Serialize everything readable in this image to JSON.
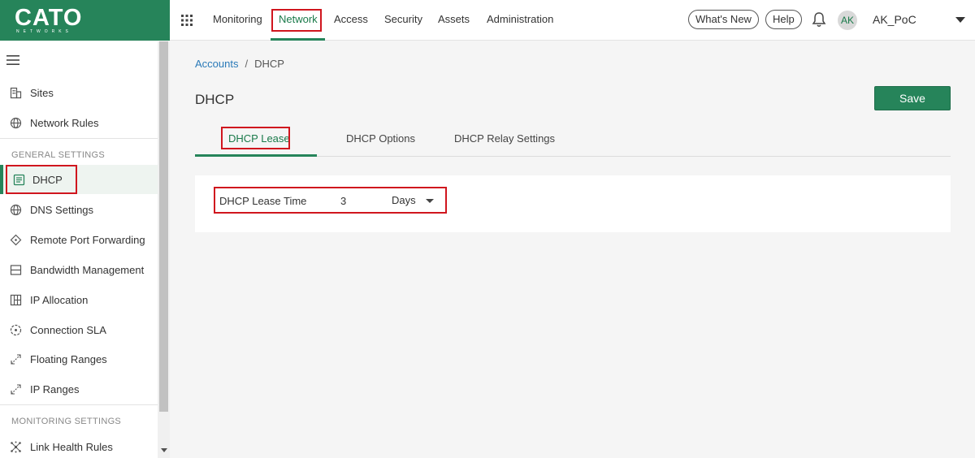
{
  "brand": {
    "name": "CATO",
    "sub": "NETWORKS",
    "color": "#26845a"
  },
  "topnav": {
    "items": [
      "Monitoring",
      "Network",
      "Access",
      "Security",
      "Assets",
      "Administration"
    ],
    "active": "Network",
    "whats_new": "What's New",
    "help": "Help",
    "avatar": "AK",
    "account": "AK_PoC"
  },
  "sidebar": {
    "items_top": [
      {
        "label": "Sites",
        "icon": "building-icon"
      },
      {
        "label": "Network Rules",
        "icon": "globe-icon"
      }
    ],
    "general_section": "GENERAL SETTINGS",
    "general_items": [
      {
        "label": "DHCP",
        "icon": "document-icon",
        "active": true
      },
      {
        "label": "DNS Settings",
        "icon": "globe-icon"
      },
      {
        "label": "Remote Port Forwarding",
        "icon": "diamond-icon"
      },
      {
        "label": "Bandwidth Management",
        "icon": "layers-icon"
      },
      {
        "label": "IP Allocation",
        "icon": "grid-table-icon"
      },
      {
        "label": "Connection SLA",
        "icon": "gauge-icon"
      },
      {
        "label": "Floating Ranges",
        "icon": "expand-arrows-icon"
      },
      {
        "label": "IP Ranges",
        "icon": "expand-arrows-icon"
      }
    ],
    "monitoring_section": "MONITORING SETTINGS",
    "monitoring_items": [
      {
        "label": "Link Health Rules",
        "icon": "network-nodes-icon"
      }
    ]
  },
  "breadcrumb": {
    "parent": "Accounts",
    "separator": "/",
    "current": "DHCP"
  },
  "page": {
    "title": "DHCP",
    "save_label": "Save",
    "tabs": [
      "DHCP Lease",
      "DHCP Options",
      "DHCP Relay Settings"
    ],
    "active_tab": "DHCP Lease",
    "lease": {
      "label": "DHCP Lease Time",
      "value": "3",
      "unit": "Days"
    }
  },
  "highlight_color": "#d0161e"
}
